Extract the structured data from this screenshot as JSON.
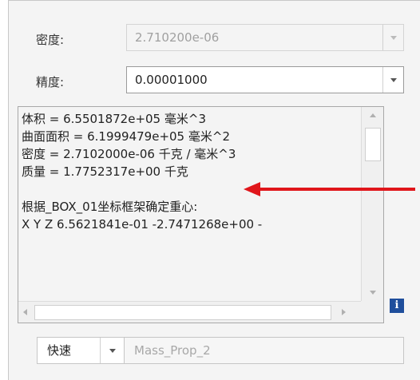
{
  "density": {
    "label": "密度:",
    "value": "2.710200e-06"
  },
  "precision": {
    "label": "精度:",
    "value": "0.00001000"
  },
  "results": {
    "lines": [
      "体积 =  6.5501872e+05  毫米^3",
      "曲面面积 =  6.1999479e+05  毫米^2",
      "密度 =  2.7102000e-06 千克 / 毫米^3",
      "质量 =  1.7752317e+00 千克",
      "",
      "根据_BOX_01坐标框架确定重心:",
      "X   Y   Z      6.5621841e-01  -2.7471268e+00  -"
    ]
  },
  "info_button": {
    "glyph": "i"
  },
  "mode": {
    "value": "快速"
  },
  "name_field": {
    "placeholder": "Mass_Prop_2"
  },
  "annotation": {
    "color": "#e0161b"
  }
}
